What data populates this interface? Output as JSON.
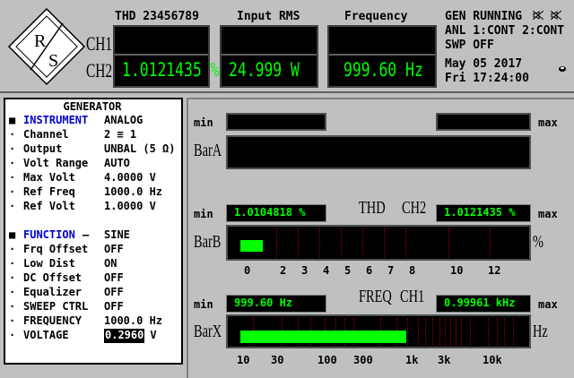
{
  "header": {
    "thd_title": "THD 23456789",
    "rms_title": "Input RMS",
    "freq_title": "Frequency",
    "ch1_label": "CH1",
    "ch2_label": "CH2",
    "ch2_thd": "1.0121435 %",
    "ch2_rms": "24.999  W",
    "ch2_freq": "999.60  Hz",
    "status_line1": "GEN RUNNING",
    "status_line2": "ANL 1:CONT 2:CONT",
    "status_line3": "SWP OFF",
    "date": "May 05 2017",
    "time": "Fri  17:24:00",
    "logo_letters": "R/S"
  },
  "generator": {
    "title": "GENERATOR",
    "rows": [
      {
        "bullet": "■",
        "label": "INSTRUMENT",
        "value": "ANALOG",
        "label_blue": true
      },
      {
        "bullet": "·",
        "label": "Channel",
        "value": "2 ≡ 1"
      },
      {
        "bullet": "·",
        "label": "Output",
        "value": "UNBAL (5 Ω)"
      },
      {
        "bullet": "·",
        "label": "Volt Range",
        "value": "AUTO"
      },
      {
        "bullet": "·",
        "label": "Max Volt",
        "value": "4.0000 V"
      },
      {
        "bullet": "·",
        "label": "Ref Freq",
        "value": "1000.0 Hz"
      },
      {
        "bullet": "·",
        "label": "Ref Volt",
        "value": "1.0000 V"
      },
      {
        "bullet": "■",
        "label": "FUNCTION",
        "value": "SINE",
        "label_blue": true,
        "dash": " — "
      },
      {
        "bullet": "·",
        "label": "Frq Offset",
        "value": "OFF"
      },
      {
        "bullet": "·",
        "label": "Low Dist",
        "value": "ON"
      },
      {
        "bullet": "·",
        "label": "DC Offset",
        "value": "OFF"
      },
      {
        "bullet": "·",
        "label": "Equalizer",
        "value": "OFF"
      },
      {
        "bullet": "·",
        "label": "SWEEP CTRL",
        "value": "OFF"
      },
      {
        "bullet": "·",
        "label": "FREQUENCY",
        "value": "1000.0 Hz"
      },
      {
        "bullet": "·",
        "label": "VOLTAGE",
        "value": "0.2960",
        "unit": "V",
        "editing": true
      }
    ]
  },
  "bars": {
    "min_label": "min",
    "max_label": "max",
    "bar_a": {
      "name": "BarA"
    },
    "bar_b": {
      "name": "BarB",
      "header_left": "THD",
      "header_right": "CH2",
      "min_value": "1.0104818 %",
      "max_value": "1.0121435 %",
      "unit": "%",
      "fill_fraction": 0.08,
      "ticks": [
        "0",
        "2",
        "3",
        "4",
        "5",
        "6",
        "7",
        "8",
        "10",
        "12"
      ]
    },
    "bar_x": {
      "name": "BarX",
      "header_left": "FREQ",
      "header_right": "CH1",
      "min_value": "999.60  Hz",
      "max_value": "0.99961 kHz",
      "unit": "Hz",
      "fill_fraction": 0.6,
      "ticks": [
        "10",
        "30",
        "100",
        "300",
        "1k",
        "3k",
        "10k"
      ]
    }
  },
  "colors": {
    "display_green": "#00ff00",
    "bar_fill": "#00ff00",
    "accent_blue": "#0000d0"
  }
}
